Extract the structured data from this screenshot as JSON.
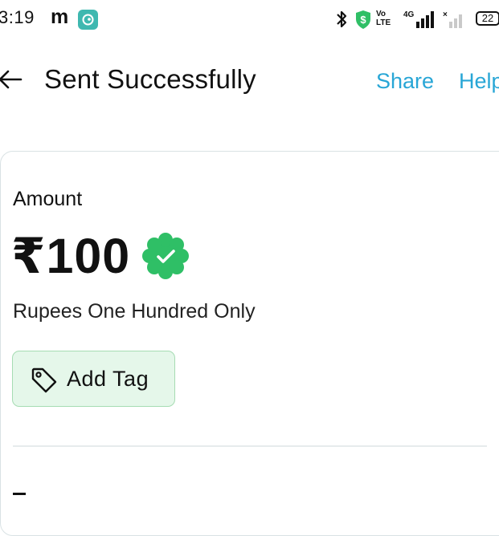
{
  "status_bar": {
    "time": "3:19",
    "app_letter": "m",
    "battery": "22",
    "volte_line1": "Vo",
    "volte_line2": "LTE",
    "network": "4G"
  },
  "header": {
    "title": "Sent Successfully",
    "share_label": "Share",
    "help_label": "Help"
  },
  "card": {
    "amount_label": "Amount",
    "amount_value": "₹100",
    "amount_words": "Rupees One Hundred Only",
    "add_tag_label": "Add Tag"
  },
  "colors": {
    "accent_link": "#28a6d6",
    "verified_green": "#2fbf66",
    "tag_bg": "#e5f7ea",
    "tag_border": "#a6dcb3"
  },
  "icons": [
    "bluetooth-icon",
    "shield-icon",
    "signal-icon",
    "battery-icon",
    "back-arrow-icon",
    "verified-badge-icon",
    "tag-icon"
  ]
}
